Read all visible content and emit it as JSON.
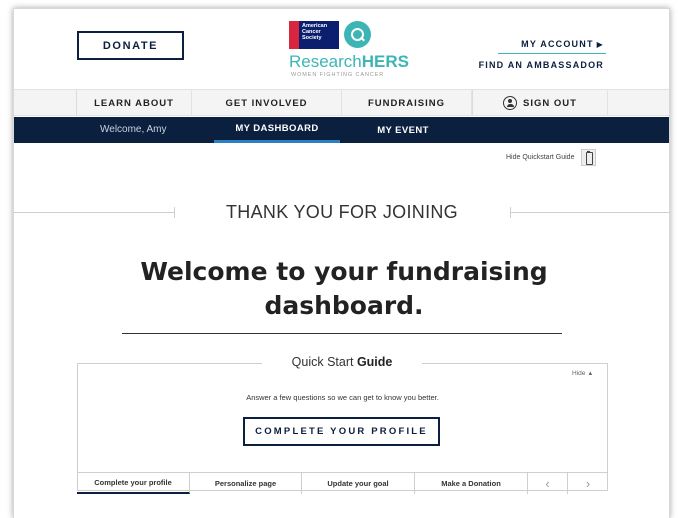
{
  "header": {
    "donate_label": "DONATE",
    "logo": {
      "acs_text": "American Cancer Society",
      "brand_prefix": "Research",
      "brand_suffix": "HERS",
      "tagline": "WOMEN FIGHTING CANCER"
    },
    "my_account_label": "MY ACCOUNT",
    "find_ambassador_label": "FIND AN AMBASSADOR",
    "accent_color": "#3db5b5"
  },
  "main_nav": {
    "items": [
      {
        "label": "LEARN ABOUT"
      },
      {
        "label": "GET INVOLVED"
      },
      {
        "label": "FUNDRAISING"
      }
    ],
    "sign_out_label": "SIGN OUT"
  },
  "dashboard_bar": {
    "welcome_text": "Welcome, Amy",
    "tabs": [
      {
        "label": "MY DASHBOARD",
        "active": true
      },
      {
        "label": "MY EVENT",
        "active": false
      }
    ],
    "bar_color": "#0b1f3f",
    "active_indicator_color": "#2d7fc1"
  },
  "quickstart_toggle": {
    "label": "Hide Quickstart Guide"
  },
  "main": {
    "thank_you": "THANK YOU FOR JOINING",
    "welcome_title": "Welcome to your fundraising dashboard."
  },
  "quick_start": {
    "title_plain": "Quick Start ",
    "title_bold": "Guide",
    "hide_label": "Hide",
    "question": "Answer a few questions so we can get to know you better.",
    "cta_label": "COMPLETE YOUR PROFILE",
    "tabs": [
      {
        "label": "Complete your profile",
        "active": true
      },
      {
        "label": "Personalize page",
        "active": false
      },
      {
        "label": "Update your goal",
        "active": false
      },
      {
        "label": "Make a Donation",
        "active": false
      }
    ]
  }
}
